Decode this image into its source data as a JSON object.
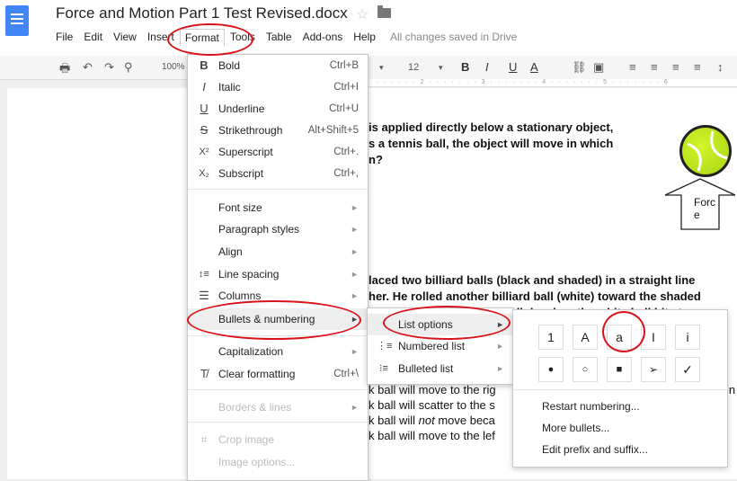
{
  "title": "Force and Motion Part 1 Test Revised.docx",
  "save_status": "All changes saved in Drive",
  "menubar": [
    "File",
    "Edit",
    "View",
    "Insert",
    "Format",
    "Tools",
    "Table",
    "Add-ons",
    "Help"
  ],
  "toolbar": {
    "zoom": "100%",
    "font_size": "12",
    "bold": "B",
    "italic": "I",
    "underline": "U",
    "text_color": "A"
  },
  "ruler": "1 · · · · · · · 2 · · · · · · · 3 · · · · · · · 4 · · · · · · · 5 · · · · · · · 6",
  "document": {
    "q1_line1": "is applied directly below a stationary object,",
    "q1_line2": "s a tennis ball, the object will move in which",
    "q1_line3": "n?",
    "force_label": "Forc\ne",
    "q2_line1": "laced two billiard balls (black and shaded) in a straight line",
    "q2_line2": "her. He rolled another billiard ball (white) toward the shaded",
    "q2_line3": "ball. What will the black ball do when the white ball hits t",
    "answer_a": "k ball will move to the rig",
    "answer_a_tail": "in",
    "answer_b": "k ball will scatter to the s",
    "answer_c_pre": "k ball will ",
    "answer_c_em": "not",
    "answer_c_post": " move beca",
    "answer_d": "k ball will move to the lef"
  },
  "format_menu": {
    "bold": {
      "label": "Bold",
      "shortcut": "Ctrl+B"
    },
    "italic": {
      "label": "Italic",
      "shortcut": "Ctrl+I"
    },
    "underline": {
      "label": "Underline",
      "shortcut": "Ctrl+U"
    },
    "strikethrough": {
      "label": "Strikethrough",
      "shortcut": "Alt+Shift+5"
    },
    "superscript": {
      "label": "Superscript",
      "shortcut": "Ctrl+."
    },
    "subscript": {
      "label": "Subscript",
      "shortcut": "Ctrl+,"
    },
    "font_size": "Font size",
    "paragraph_styles": "Paragraph styles",
    "align": "Align",
    "line_spacing": "Line spacing",
    "columns": "Columns",
    "bullets_numbering": "Bullets & numbering",
    "capitalization": "Capitalization",
    "clear_formatting": {
      "label": "Clear formatting",
      "shortcut": "Ctrl+\\"
    },
    "borders_lines": "Borders & lines",
    "crop_image": "Crop image",
    "image_options": "Image options..."
  },
  "bullets_menu": {
    "list_options": "List options",
    "numbered_list": "Numbered list",
    "bulleted_list": "Bulleted list"
  },
  "list_options": {
    "numbered_styles": [
      "1",
      "A",
      "a",
      "I",
      "i"
    ],
    "bullet_styles": [
      "●",
      "○",
      "■",
      "➢",
      "✓"
    ],
    "restart_numbering": "Restart numbering...",
    "more_bullets": "More bullets...",
    "edit_prefix_suffix": "Edit prefix and suffix..."
  },
  "icons": {
    "star": "☆",
    "bold": "B",
    "italic": "I",
    "underline": "U",
    "strikethrough": "S",
    "superscript": "X²",
    "subscript": "X₂",
    "line_spacing": "↕≡",
    "columns": "☰",
    "clear_formatting": "T̸",
    "crop": "⌗",
    "numbered_list": "⋮≡",
    "bulleted_list": "⁝≡",
    "submenu_arrow": "►"
  },
  "colors": {
    "annotation_red": "#d9131b",
    "docs_blue": "#4285f4",
    "tennis_green": "#c5ee22"
  }
}
